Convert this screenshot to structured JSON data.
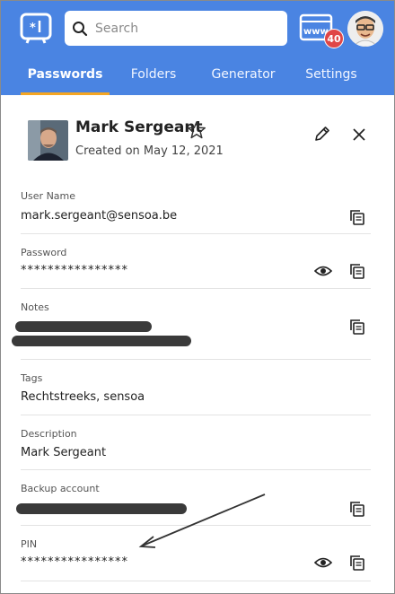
{
  "header": {
    "search_placeholder": "Search",
    "badge_count": "40"
  },
  "tabs": [
    {
      "label": "Passwords",
      "active": true
    },
    {
      "label": "Folders",
      "active": false
    },
    {
      "label": "Generator",
      "active": false
    },
    {
      "label": "Settings",
      "active": false
    }
  ],
  "item": {
    "name": "Mark Sergeant",
    "created": "Created on May 12, 2021"
  },
  "fields": {
    "username": {
      "label": "User Name",
      "value": "mark.sergeant@sensoa.be"
    },
    "password": {
      "label": "Password",
      "value": "****************"
    },
    "notes": {
      "label": "Notes"
    },
    "tags": {
      "label": "Tags",
      "value": "Rechtstreeks, sensoa"
    },
    "description": {
      "label": "Description",
      "value": "Mark Sergeant"
    },
    "backup": {
      "label": "Backup account"
    },
    "pin": {
      "label": "PIN",
      "value": "****************"
    }
  },
  "colors": {
    "header": "#4a84e2",
    "active_tab_underline": "#f5a623",
    "badge": "#e04646"
  }
}
